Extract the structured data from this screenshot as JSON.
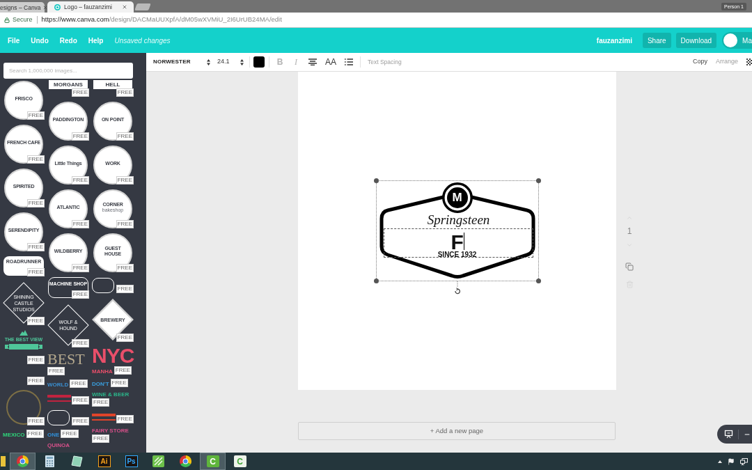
{
  "browser": {
    "tabs": [
      {
        "title": "esigns – Canva",
        "selected": false
      },
      {
        "title": "Logo – fauzanzimi",
        "selected": true
      }
    ],
    "profile": "Person 1",
    "address_bar": {
      "security_label": "Secure",
      "url_host": "https://www.canva.com",
      "url_path": "/design/DACMaUUXpfA/dM05wXVMiU_2I6UrUB24MA/edit"
    }
  },
  "header": {
    "menu": [
      "File",
      "Undo",
      "Redo",
      "Help"
    ],
    "save_status": "Unsaved changes",
    "username": "fauzanzimi",
    "buttons": [
      "Share",
      "Download"
    ],
    "account_label": "Ma"
  },
  "sidebar": {
    "search": {
      "placeholder": "Search 1,000,000 images..."
    },
    "template_columns": [
      [
        {
          "kind": "circle",
          "title": "FRISCO",
          "badge": "FREE"
        },
        {
          "kind": "circle",
          "title": "FRENCH CAFE",
          "badge": "FREE"
        },
        {
          "kind": "circle",
          "title": "SPIRITED",
          "badge": "FREE"
        },
        {
          "kind": "circle",
          "title": "SERENDIPITY",
          "badge": "FREE"
        },
        {
          "kind": "badge",
          "title": "ROADRUNNER",
          "badge": "FREE"
        },
        {
          "kind": "diamond",
          "title": "SHINING CASTLE STUDIOS",
          "badge": "FREE"
        },
        {
          "kind": "emblem_text",
          "title": "THE BEST VIEW",
          "color": "#4fc79a",
          "badge": "FREE"
        },
        {
          "kind": "blank",
          "badge": "FREE"
        },
        {
          "kind": "ring",
          "color": "#7d6f45",
          "badge": "FREE"
        },
        {
          "kind": "text",
          "title": "MEXICO",
          "color": "#2ed47a",
          "badge": "FREE"
        }
      ],
      [
        {
          "kind": "banner",
          "title": "MORGANS",
          "badge": "FREE"
        },
        {
          "kind": "circle",
          "title": "PADDINGTON",
          "badge": "FREE"
        },
        {
          "kind": "circle",
          "title": "Little Things",
          "badge": "FREE"
        },
        {
          "kind": "circle",
          "title": "ATLANTIC",
          "badge": "FREE"
        },
        {
          "kind": "circle",
          "title": "WILDBERRY",
          "badge": "FREE"
        },
        {
          "kind": "outline_badge",
          "title": "MACHINE SHOP",
          "badge": "FREE"
        },
        {
          "kind": "diamond",
          "title": "WOLF & HOUND",
          "badge": "FREE"
        },
        {
          "kind": "serif_headline",
          "title": "BEST",
          "color": "#b5a98e",
          "badge": "FREE"
        },
        {
          "kind": "text",
          "title": "WORLD",
          "color": "#3a8fd0",
          "badge": "FREE"
        },
        {
          "kind": "artwork",
          "color": "#c0233f",
          "badge": "FREE"
        },
        {
          "kind": "outline_badge",
          "badge": "FREE"
        },
        {
          "kind": "text",
          "title": "ONE",
          "color": "#2f8fd8",
          "badge": "FREE"
        },
        {
          "kind": "text",
          "title": "QUINOA",
          "color": "#d8508a"
        }
      ],
      [
        {
          "kind": "banner",
          "title": "HELL",
          "badge": "FREE"
        },
        {
          "kind": "circle",
          "title": "ON POINT",
          "badge": "FREE"
        },
        {
          "kind": "circle",
          "title": "WORK",
          "badge": "FREE"
        },
        {
          "kind": "circle",
          "title": "CORNER",
          "subtitle": "bakeshop",
          "badge": "FREE"
        },
        {
          "kind": "circle",
          "title": "GUEST HOUSE",
          "badge": "FREE"
        },
        {
          "kind": "outline_badge",
          "badge": "FREE"
        },
        {
          "kind": "solid_diamond",
          "title": "BREWERY",
          "badge": "FREE"
        },
        {
          "kind": "headline",
          "title": "NYC",
          "subtitle": "MANHA",
          "color": "#e94f6a",
          "badge": "FREE"
        },
        {
          "kind": "text",
          "title": "DON'T",
          "color": "#3aa0e0",
          "badge": "FREE"
        },
        {
          "kind": "text",
          "title": "WINE & BEER",
          "color": "#2bb58a",
          "badge": "FREE"
        },
        {
          "kind": "artwork",
          "color": "#e0442a",
          "badge": "FREE"
        },
        {
          "kind": "text",
          "title": "FAIRY STORE",
          "color": "#d8508a",
          "badge": "FREE"
        }
      ]
    ]
  },
  "text_toolbar": {
    "font": "NORWESTER",
    "font_size": "24.1",
    "buttons": [
      {
        "kind": "bold",
        "label": "B",
        "disabled": true
      },
      {
        "kind": "italic",
        "label": "I",
        "disabled": true
      },
      {
        "kind": "align_center",
        "disabled": false
      },
      {
        "kind": "case",
        "label": "AA",
        "disabled": false
      },
      {
        "kind": "list",
        "disabled": false
      }
    ],
    "spacing": {
      "label": "Text Spacing",
      "disabled": true
    },
    "actions": [
      {
        "label": "Copy",
        "disabled": false
      },
      {
        "label": "Arrange",
        "disabled": true
      }
    ]
  },
  "canvas": {
    "design": {
      "selected": true,
      "emblem_letter": "M",
      "script_title": "Springsteen",
      "text_box": {
        "value": "F",
        "editing": true
      },
      "tagline": "SINCE 1932"
    },
    "page_controls": [
      {
        "kind": "move_up",
        "disabled": true
      },
      {
        "kind": "page_number",
        "label": "1"
      },
      {
        "kind": "move_down",
        "disabled": true
      },
      {
        "kind": "duplicate",
        "disabled": false
      },
      {
        "kind": "delete",
        "disabled": true
      }
    ],
    "add_page": "+ Add a new page"
  },
  "taskbar": {
    "apps": [
      {
        "kind": "folder",
        "active": false
      },
      {
        "kind": "browser",
        "active": true
      },
      {
        "kind": "calculator",
        "active": false
      },
      {
        "kind": "glass",
        "active": false
      },
      {
        "kind": "tile_dark",
        "label": "Ai",
        "color": "#f7a21b",
        "active": false
      },
      {
        "kind": "tile_dark",
        "label": "Ps",
        "color": "#31a8ff",
        "active": false
      },
      {
        "kind": "striped",
        "active": false
      },
      {
        "kind": "browser",
        "active": false
      },
      {
        "kind": "tile_filled",
        "label": "C",
        "color": "#5fb53c",
        "active": true
      },
      {
        "kind": "tile_light",
        "label": "C",
        "color": "#3fa535",
        "active": false
      }
    ]
  }
}
